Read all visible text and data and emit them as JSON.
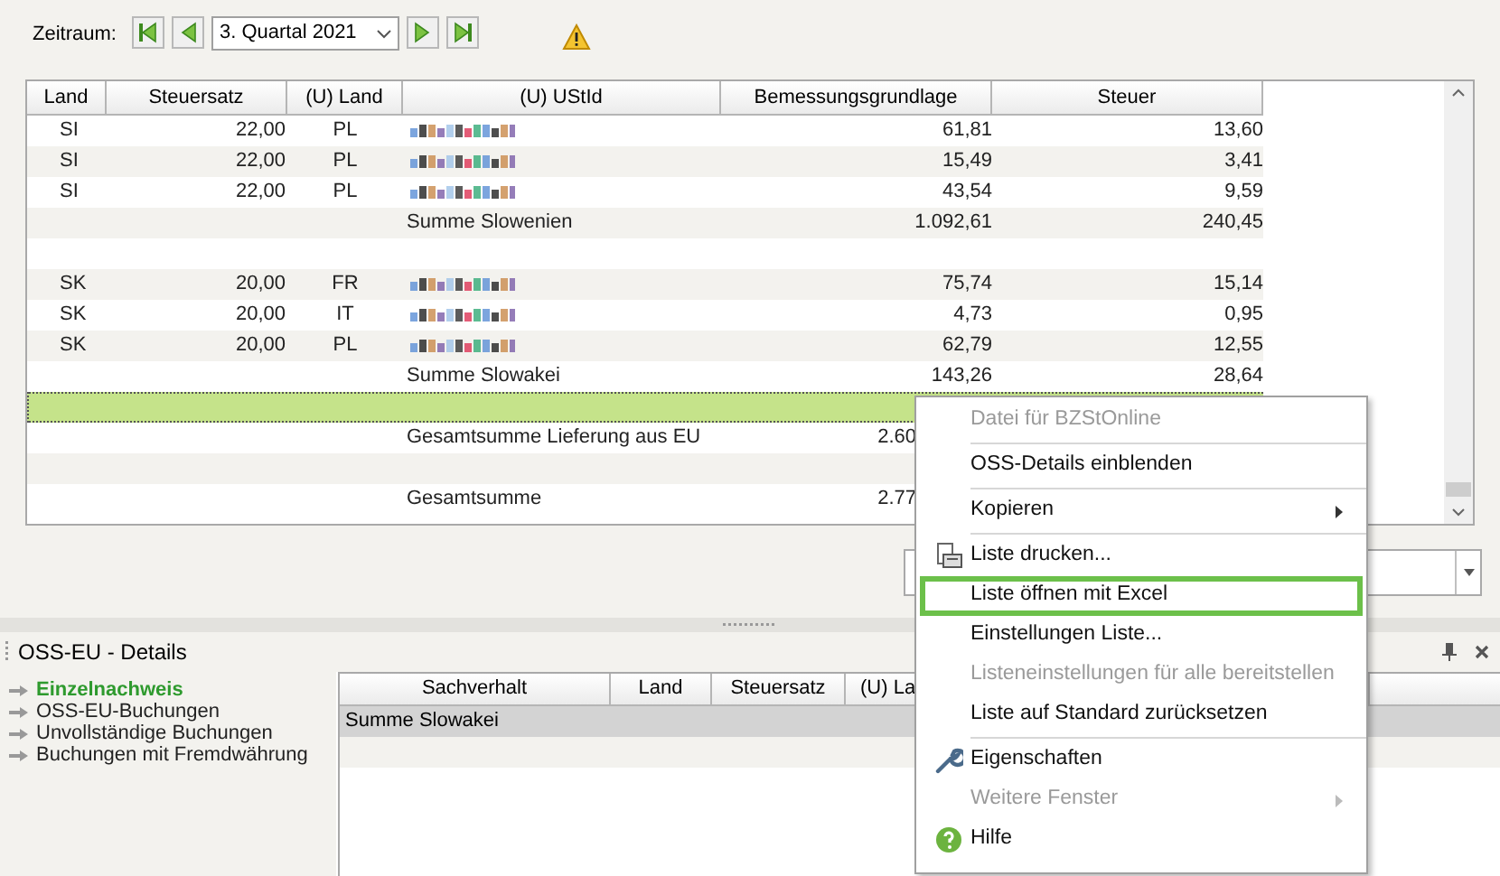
{
  "toolbar": {
    "label": "Zeitraum:",
    "period": "3. Quartal 2021"
  },
  "table": {
    "columns": [
      "Land",
      "Steuersatz",
      "(U) Land",
      "(U) UStId",
      "Bemessungsgrundlage",
      "Steuer"
    ],
    "rows": [
      {
        "kind": "data",
        "selected": false,
        "land": "SI",
        "rate": "22,00",
        "u_land": "PL",
        "ustid_redacted": true,
        "base": "61,81",
        "tax": "13,60"
      },
      {
        "kind": "data",
        "selected": false,
        "land": "SI",
        "rate": "22,00",
        "u_land": "PL",
        "ustid_redacted": true,
        "base": "15,49",
        "tax": "3,41"
      },
      {
        "kind": "data",
        "selected": false,
        "land": "SI",
        "rate": "22,00",
        "u_land": "PL",
        "ustid_redacted": true,
        "base": "43,54",
        "tax": "9,59"
      },
      {
        "kind": "sum",
        "selected": false,
        "label": "Summe Slowenien",
        "base": "1.092,61",
        "tax": "240,45"
      },
      {
        "kind": "blank",
        "selected": false
      },
      {
        "kind": "data",
        "selected": false,
        "land": "SK",
        "rate": "20,00",
        "u_land": "FR",
        "ustid_redacted": true,
        "base": "75,74",
        "tax": "15,14"
      },
      {
        "kind": "data",
        "selected": false,
        "land": "SK",
        "rate": "20,00",
        "u_land": "IT",
        "ustid_redacted": true,
        "base": "4,73",
        "tax": "0,95"
      },
      {
        "kind": "data",
        "selected": false,
        "land": "SK",
        "rate": "20,00",
        "u_land": "PL",
        "ustid_redacted": true,
        "base": "62,79",
        "tax": "12,55"
      },
      {
        "kind": "sum",
        "selected": false,
        "label": "Summe Slowakei",
        "base": "143,26",
        "tax": "28,64"
      },
      {
        "kind": "blank",
        "selected": true
      },
      {
        "kind": "sum",
        "selected": false,
        "label": "Gesamtsumme Lieferung aus EU",
        "base": "2.60",
        "base_cut": true
      },
      {
        "kind": "blank",
        "selected": false
      },
      {
        "kind": "sum",
        "selected": false,
        "label": "Gesamtsumme",
        "base": "2.77",
        "base_cut": true
      }
    ]
  },
  "details": {
    "title": "OSS-EU - Details",
    "links": [
      {
        "label": "Einzelnachweis",
        "selected": true
      },
      {
        "label": "OSS-EU-Buchungen",
        "selected": false
      },
      {
        "label": "Unvollständige Buchungen",
        "selected": false
      },
      {
        "label": "Buchungen mit Fremdwährung",
        "selected": false
      }
    ],
    "columns": [
      "Sachverhalt",
      "Land",
      "Steuersatz",
      "(U) La"
    ],
    "rows": [
      {
        "label": "Summe Slowakei",
        "selected": true
      }
    ]
  },
  "context_menu": {
    "items": [
      {
        "kind": "plain",
        "label": "Datei für BZStOnline",
        "disabled": true,
        "separator_after": true
      },
      {
        "kind": "plain",
        "label": "OSS-Details einblenden",
        "disabled": false,
        "separator_after": true
      },
      {
        "kind": "plain",
        "label": "Kopieren",
        "disabled": false,
        "submenu": true,
        "separator_after": true
      },
      {
        "kind": "print",
        "label": "Liste drucken...",
        "disabled": false
      },
      {
        "kind": "plain",
        "label": "Liste öffnen mit Excel",
        "disabled": false,
        "highlighted": true
      },
      {
        "kind": "plain",
        "label": "Einstellungen Liste...",
        "disabled": false
      },
      {
        "kind": "plain",
        "label": "Listeneinstellungen für alle bereitstellen",
        "disabled": true
      },
      {
        "kind": "plain",
        "label": "Liste auf Standard zurücksetzen",
        "disabled": false,
        "separator_after": true
      },
      {
        "kind": "properties",
        "label": "Eigenschaften",
        "disabled": false
      },
      {
        "kind": "plain",
        "label": "Weitere Fenster",
        "disabled": true,
        "submenu": true
      },
      {
        "kind": "help",
        "label": "Hilfe",
        "disabled": false
      }
    ]
  }
}
